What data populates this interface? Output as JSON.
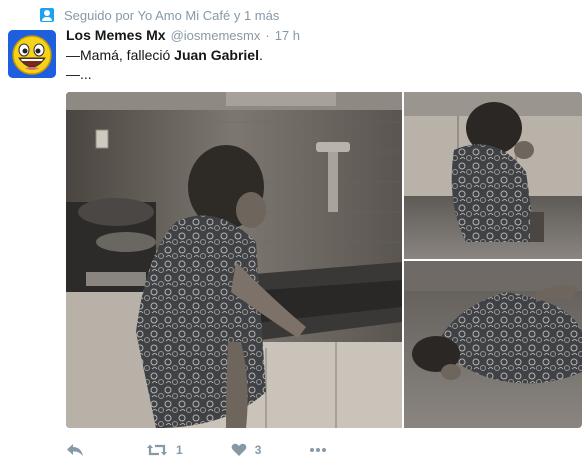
{
  "context": {
    "icon": "follow-icon",
    "text": "Seguido por Yo Amo Mi Café y 1 más"
  },
  "tweet": {
    "author_name": "Los Memes Mx",
    "author_handle": "@iosmemesmx",
    "separator": "·",
    "timestamp": "17 h",
    "avatar_icon": "laughing-smiley-face",
    "text_prefix": "—Mamá, falleció ",
    "text_bold": "Juan Gabriel",
    "text_suffix": ".",
    "text_line2": "—..."
  },
  "media": {
    "images": [
      {
        "description_icon": "photo-woman-kitchen"
      },
      {
        "description_icon": "photo-woman-kneeling"
      },
      {
        "description_icon": "photo-woman-floor"
      }
    ]
  },
  "actions": {
    "reply": {
      "icon": "reply-icon"
    },
    "retweet": {
      "icon": "retweet-icon",
      "count": "1"
    },
    "like": {
      "icon": "heart-icon",
      "count": "3"
    },
    "more": {
      "icon": "more-icon"
    }
  },
  "colors": {
    "accent": "#1da1f2",
    "muted": "#8899a6",
    "text": "#14171a",
    "avatar_bg": "#1e5fe0",
    "smiley": "#f7d21a"
  }
}
